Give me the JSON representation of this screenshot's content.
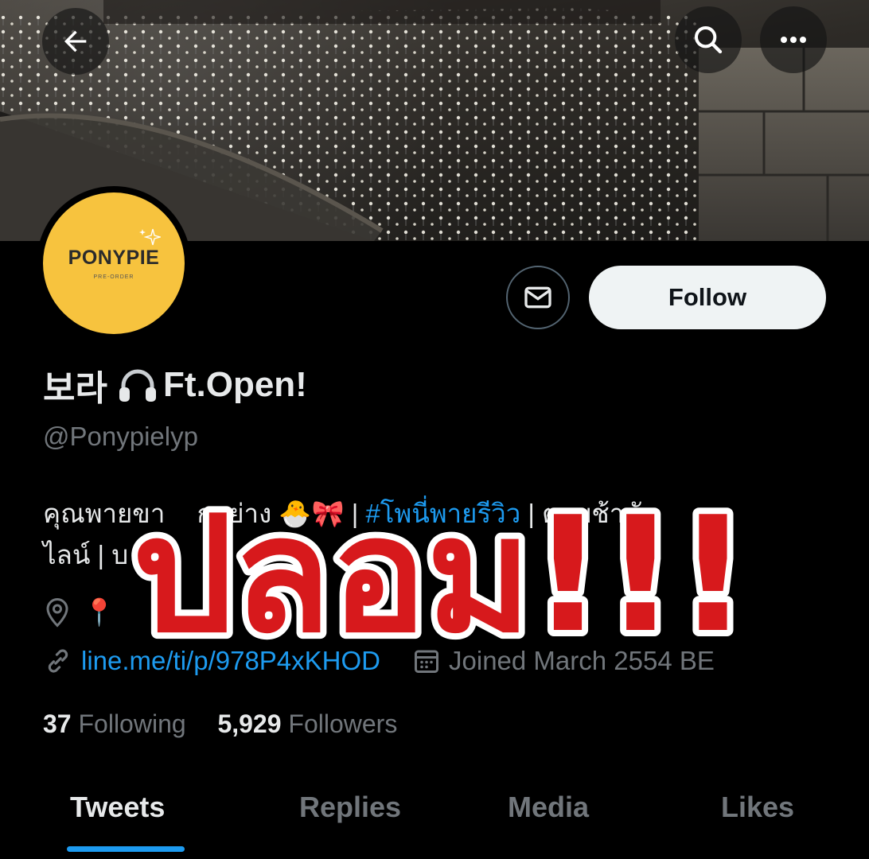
{
  "header": {
    "back_icon": "arrow-left-icon",
    "search_icon": "search-icon",
    "more_icon": "more-horizontal-icon"
  },
  "avatar": {
    "brand": "PONYPIE",
    "sub": "PRE-ORDER"
  },
  "actions": {
    "message_icon": "mail-icon",
    "follow_label": "Follow"
  },
  "profile": {
    "display_name_korean": "보라",
    "display_name_rest": "Ft.Open!",
    "handle": "@Ponypielyp",
    "bio_line1_start": "คุณพายขา",
    "bio_line1_mid": "กอย่าง 🐣🎀 | ",
    "bio_hashtag": "#โพนี่พายรีวิว",
    "bio_line1_end": " | ตอบช้าทัก",
    "bio_line2": "ไลน์ | บ",
    "location_text": "📍",
    "link_text": "line.me/ti/p/978P4xKHOD",
    "joined_text": "Joined March 2554 BE"
  },
  "stats": {
    "following_count": "37",
    "following_label": "Following",
    "followers_count": "5,929",
    "followers_label": "Followers"
  },
  "tabs": [
    {
      "label": "Tweets",
      "active": true
    },
    {
      "label": "Replies",
      "active": false
    },
    {
      "label": "Media",
      "active": false
    },
    {
      "label": "Likes",
      "active": false
    }
  ],
  "overlay": {
    "text": "ปลอม!!!",
    "fill_color": "#d7191c",
    "stroke_color": "#ffffff"
  },
  "colors": {
    "accent": "#1d9bf0",
    "background": "#000000",
    "muted": "#71767b"
  }
}
